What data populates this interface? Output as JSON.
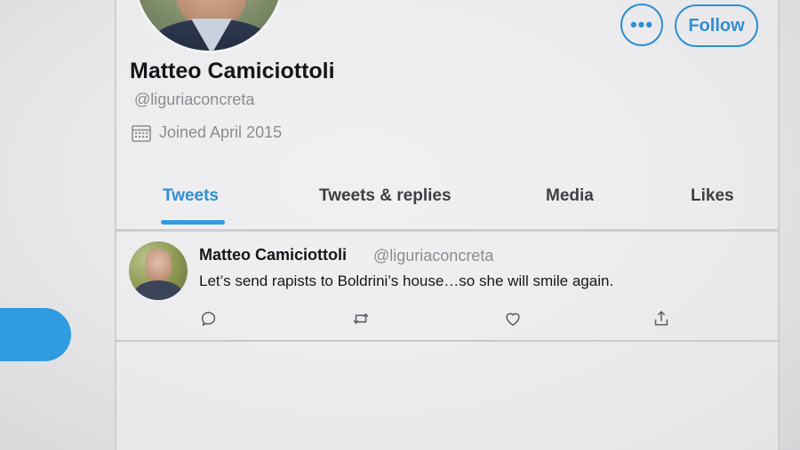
{
  "profile": {
    "name": "Matteo Camiciottoli",
    "handle": "@liguriaconcreta",
    "joined": "Joined April 2015"
  },
  "header_actions": {
    "more_label": "•••",
    "follow_label": "Follow"
  },
  "tabs": [
    {
      "label": "Tweets",
      "active": true
    },
    {
      "label": "Tweets & replies",
      "active": false
    },
    {
      "label": "Media",
      "active": false
    },
    {
      "label": "Likes",
      "active": false
    }
  ],
  "tweet": {
    "author_name": "Matteo Camiciottoli",
    "author_handle": "@liguriaconcreta",
    "text": "Let’s send rapists to Boldrini’s house…so she will smile again.",
    "actions": [
      "reply-icon",
      "retweet-icon",
      "like-icon",
      "share-icon"
    ]
  },
  "colors": {
    "accent": "#2f8fd0",
    "text_primary": "#14171a",
    "text_secondary": "#8a8d91"
  }
}
